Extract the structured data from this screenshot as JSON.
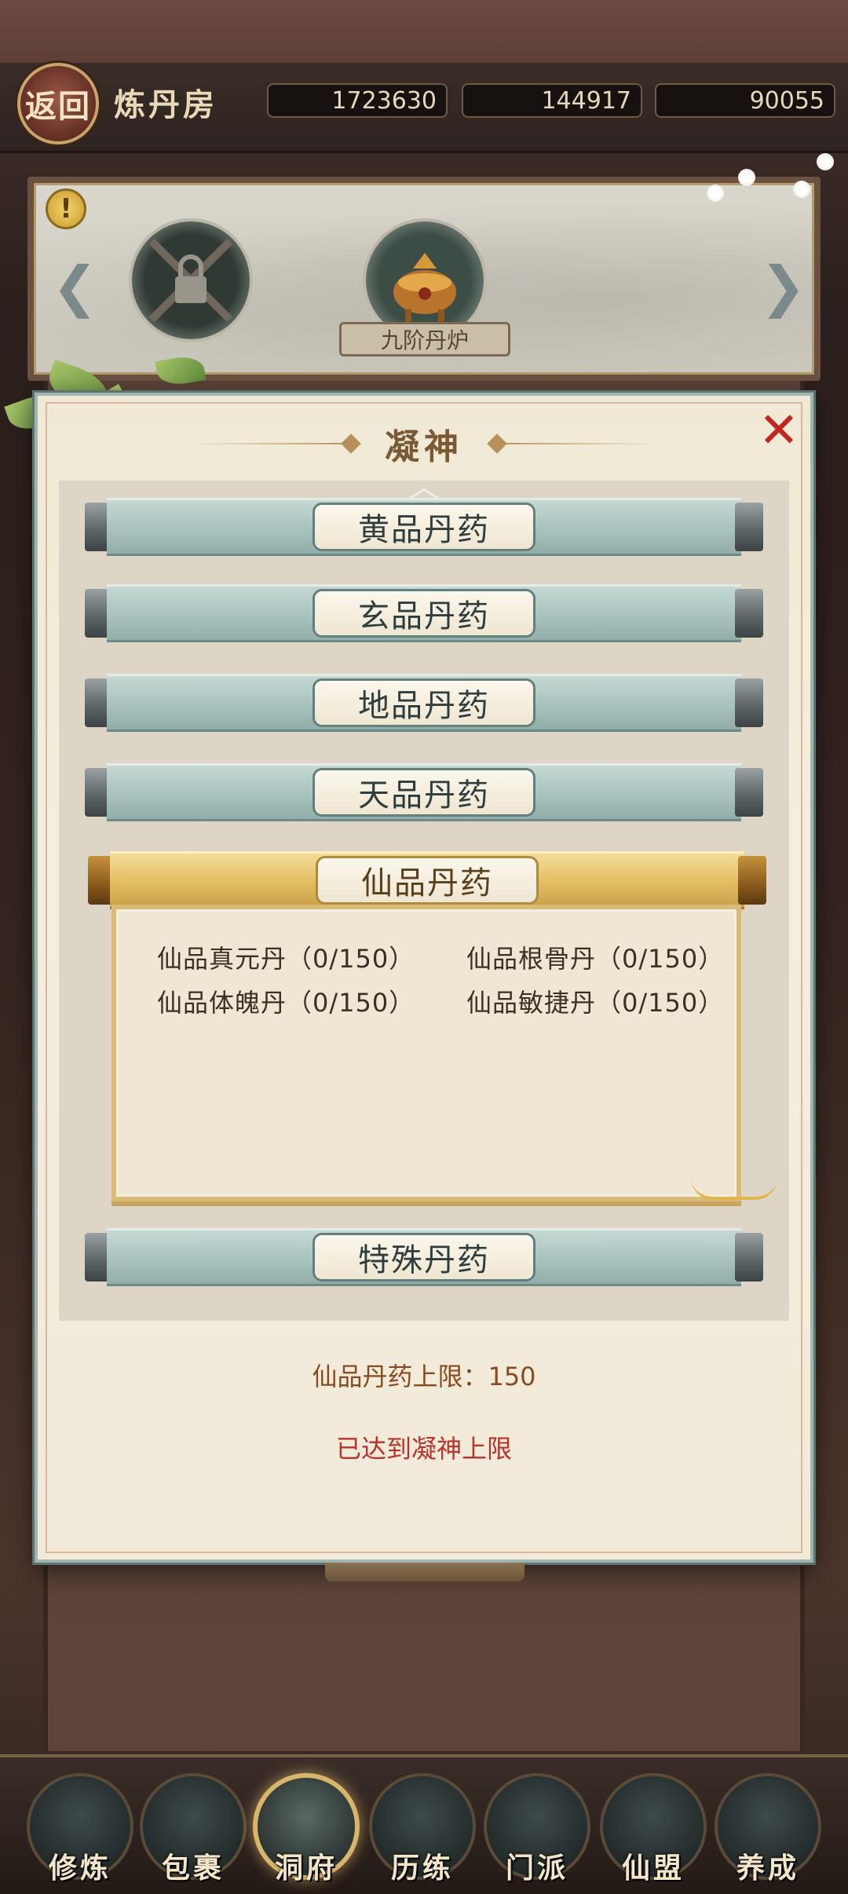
{
  "header": {
    "back_label": "返回",
    "title": "炼丹房",
    "resources": [
      {
        "icon": "meat-icon",
        "value": "1723630"
      },
      {
        "icon": "wood-log-icon",
        "value": "144917"
      },
      {
        "icon": "ore-icon",
        "value": "90055"
      }
    ]
  },
  "furnace": {
    "warning_icon": "!",
    "arrow_left": "❮",
    "arrow_right": "❯",
    "selected_label": "九阶丹炉"
  },
  "dialog": {
    "title": "凝神",
    "close_icon": "✕",
    "categories": [
      {
        "label": "黄品丹药"
      },
      {
        "label": "玄品丹药"
      },
      {
        "label": "地品丹药"
      },
      {
        "label": "天品丹药"
      },
      {
        "label": "仙品丹药"
      },
      {
        "label": "特殊丹药"
      }
    ],
    "expanded_items": [
      "仙品真元丹（0/150）",
      "仙品根骨丹（0/150）",
      "仙品体魄丹（0/150）",
      "仙品敏捷丹（0/150）"
    ],
    "limit_text": "仙品丹药上限：150",
    "status_text": "已达到凝神上限"
  },
  "bottom_nav": [
    {
      "label": "修炼"
    },
    {
      "label": "包裹"
    },
    {
      "label": "洞府"
    },
    {
      "label": "历练"
    },
    {
      "label": "门派"
    },
    {
      "label": "仙盟"
    },
    {
      "label": "养成"
    }
  ],
  "colors": {
    "accent_gold": "#d9bb77",
    "warning_red": "#b8332a",
    "limit_brown": "#8a4a1f"
  }
}
